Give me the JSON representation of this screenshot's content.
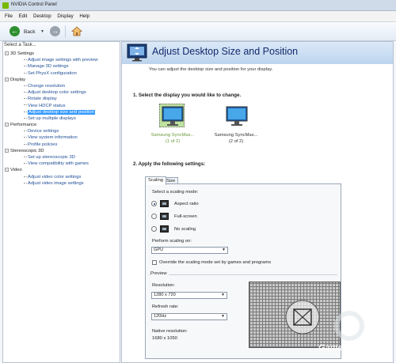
{
  "window": {
    "title": "NVIDIA Control Panel"
  },
  "menu": [
    "File",
    "Edit",
    "Desktop",
    "Display",
    "Help"
  ],
  "toolbar": {
    "back_label": "Back",
    "back_icon": "back-arrow-icon",
    "forward_icon": "forward-arrow-icon",
    "home_icon": "home-icon"
  },
  "sidebar": {
    "header": "Select a Task...",
    "tree": [
      {
        "type": "cat",
        "label": "3D Settings"
      },
      {
        "type": "item",
        "label": "Adjust image settings with preview"
      },
      {
        "type": "item",
        "label": "Manage 3D settings"
      },
      {
        "type": "item",
        "label": "Set PhysX configuration"
      },
      {
        "type": "cat",
        "label": "Display"
      },
      {
        "type": "item",
        "label": "Change resolution"
      },
      {
        "type": "item",
        "label": "Adjust desktop color settings"
      },
      {
        "type": "item",
        "label": "Rotate display"
      },
      {
        "type": "item",
        "label": "View HDCP status"
      },
      {
        "type": "item",
        "label": "Adjust desktop size and position",
        "selected": true
      },
      {
        "type": "item",
        "label": "Set up multiple displays"
      },
      {
        "type": "cat",
        "label": "Performance"
      },
      {
        "type": "item",
        "label": "Device settings"
      },
      {
        "type": "item",
        "label": "View system information"
      },
      {
        "type": "item",
        "label": "Profile policies"
      },
      {
        "type": "cat",
        "label": "Stereoscopic 3D"
      },
      {
        "type": "item",
        "label": "Set up stereoscopic 3D"
      },
      {
        "type": "item",
        "label": "View compatibility with games"
      },
      {
        "type": "cat",
        "label": "Video"
      },
      {
        "type": "item",
        "label": "Adjust video color settings"
      },
      {
        "type": "item",
        "label": "Adjust video image settings"
      }
    ]
  },
  "main": {
    "title": "Adjust Desktop Size and Position",
    "description": "You can adjust the desktop size and position for your display.",
    "section1": "1. Select the display you would like to change.",
    "displays": [
      {
        "name": "Samsung SyncMas...",
        "number": "(1 of 2)",
        "selected": true
      },
      {
        "name": "Samsung SyncMas...",
        "number": "(2 of 2)",
        "selected": false
      }
    ],
    "section2": "2. Apply the following settings:",
    "tabs": [
      "Scaling",
      "Size"
    ],
    "scaling_mode_label": "Select a scaling mode:",
    "modes": [
      "Aspect ratio",
      "Full-screen",
      "No scaling"
    ],
    "selected_mode": "Aspect ratio",
    "perform_scaling_label": "Perform scaling on:",
    "perform_scaling_value": "GPU",
    "override_label": "Override the scaling mode set by games and programs",
    "preview_label": "Preview",
    "resolution_label": "Resolution:",
    "resolution_value": "1280 x 720",
    "refresh_label": "Refresh rate:",
    "refresh_value": "120Hz",
    "native_label": "Native resolution:",
    "native_value": "1680 x 1050"
  },
  "watermark": "GameGuru",
  "colors": {
    "accent": "#76b900",
    "selection": "#3399ff",
    "title_text": "#13286b"
  }
}
